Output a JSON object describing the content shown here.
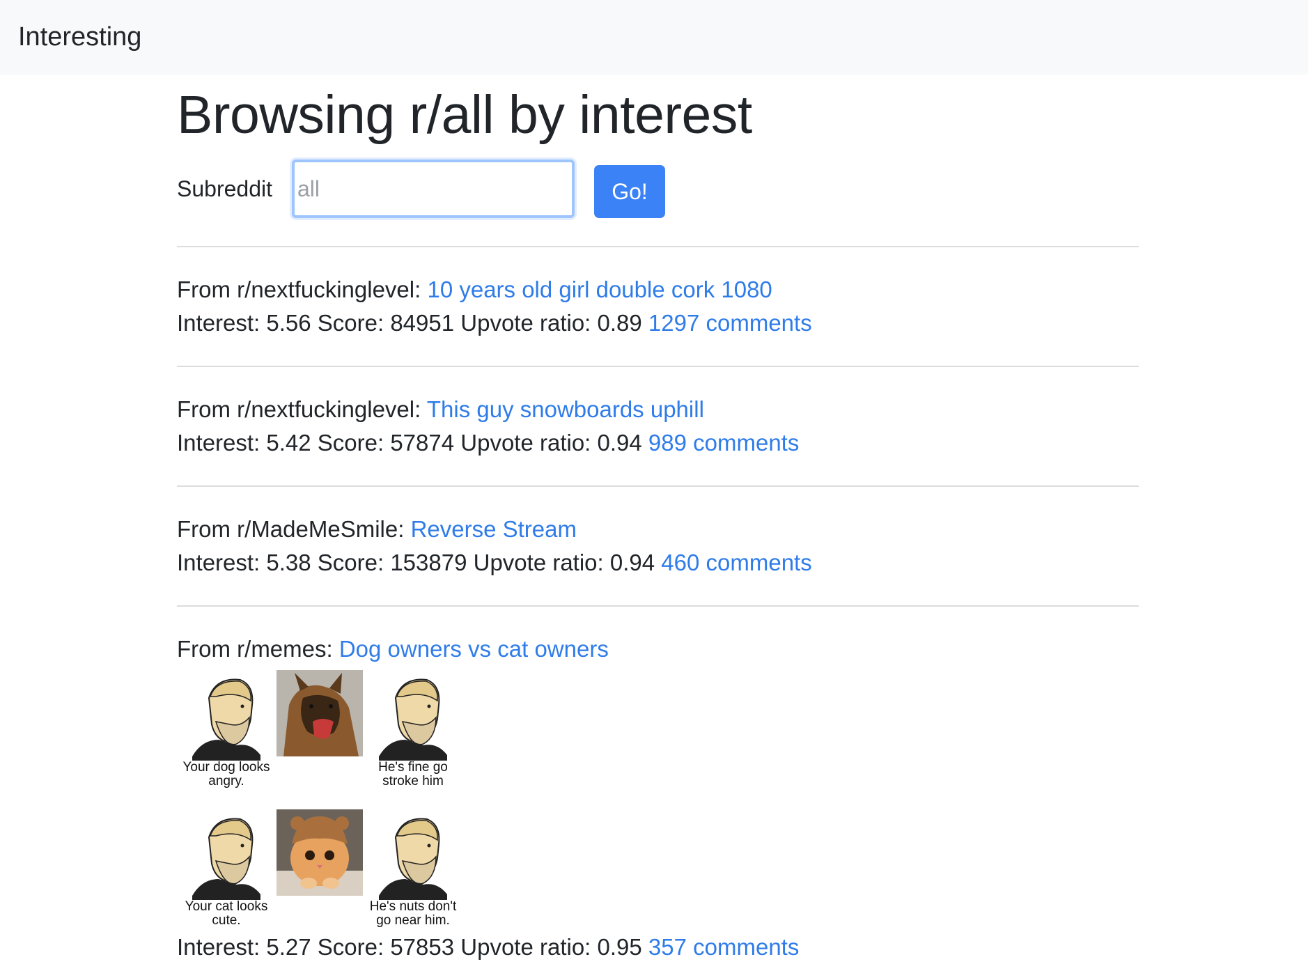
{
  "navbar": {
    "brand": "Interesting"
  },
  "header": {
    "title": "Browsing r/all by interest"
  },
  "form": {
    "label": "Subreddit",
    "placeholder": "all",
    "button": "Go!"
  },
  "posts": [
    {
      "prefix": "From r/nextfuckinglevel: ",
      "title": "10 years old girl double cork 1080",
      "stats": "Interest: 5.56 Score: 84951 Upvote ratio: 0.89 ",
      "comments": "1297 comments"
    },
    {
      "prefix": "From r/nextfuckinglevel: ",
      "title": "This guy snowboards uphill",
      "stats": "Interest: 5.42 Score: 57874 Upvote ratio: 0.94 ",
      "comments": "989 comments"
    },
    {
      "prefix": "From r/MadeMeSmile: ",
      "title": "Reverse Stream",
      "stats": "Interest: 5.38 Score: 153879 Upvote ratio: 0.94 ",
      "comments": "460 comments"
    },
    {
      "prefix": "From r/memes: ",
      "title": "Dog owners vs cat owners",
      "stats": "Interest: 5.27 Score: 57853 Upvote ratio: 0.95 ",
      "comments": "357 comments"
    }
  ],
  "meme": {
    "caption_1": "Your dog looks angry.",
    "caption_2": "He's fine go stroke him",
    "caption_3": "Your cat looks cute.",
    "caption_4": "He's nuts don't go near him."
  }
}
